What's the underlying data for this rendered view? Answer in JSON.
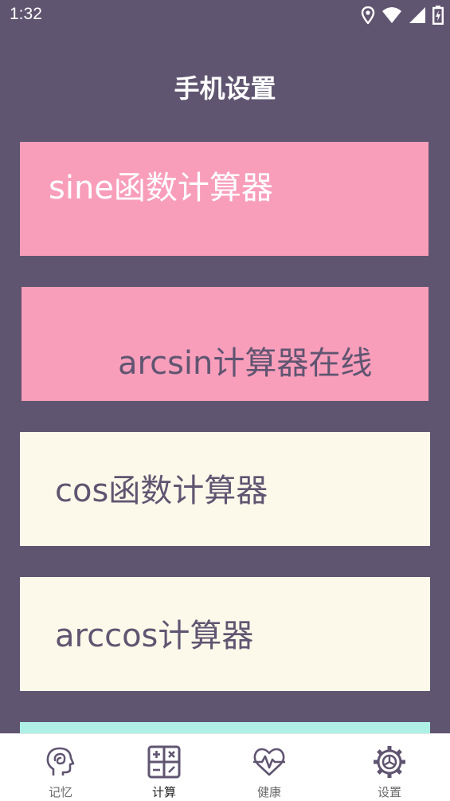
{
  "status_bar": {
    "time": "1:32",
    "icons": [
      "location-icon",
      "wifi-icon",
      "signal-icon",
      "battery-charging-icon"
    ]
  },
  "page": {
    "title": "手机设置"
  },
  "cards": [
    {
      "label": "sine函数计算器",
      "color": "#f89ebb"
    },
    {
      "label": "arcsin计算器在线",
      "color": "#f89ebb"
    },
    {
      "label": "cos函数计算器",
      "color": "#fdf9ea"
    },
    {
      "label": "arccos计算器",
      "color": "#fdf9ea"
    },
    {
      "label": "",
      "color": "#aef0e6"
    }
  ],
  "bottom_nav": {
    "items": [
      {
        "label": "记忆",
        "icon": "brain-head-icon",
        "active": false
      },
      {
        "label": "计算",
        "icon": "calculator-icon",
        "active": true
      },
      {
        "label": "健康",
        "icon": "heartbeat-icon",
        "active": false
      },
      {
        "label": "设置",
        "icon": "gear-icon",
        "active": false
      }
    ]
  },
  "colors": {
    "background": "#605571",
    "text": "#605571",
    "pink": "#f89ebb",
    "cream": "#fdf9ea",
    "mint": "#aef0e6"
  }
}
